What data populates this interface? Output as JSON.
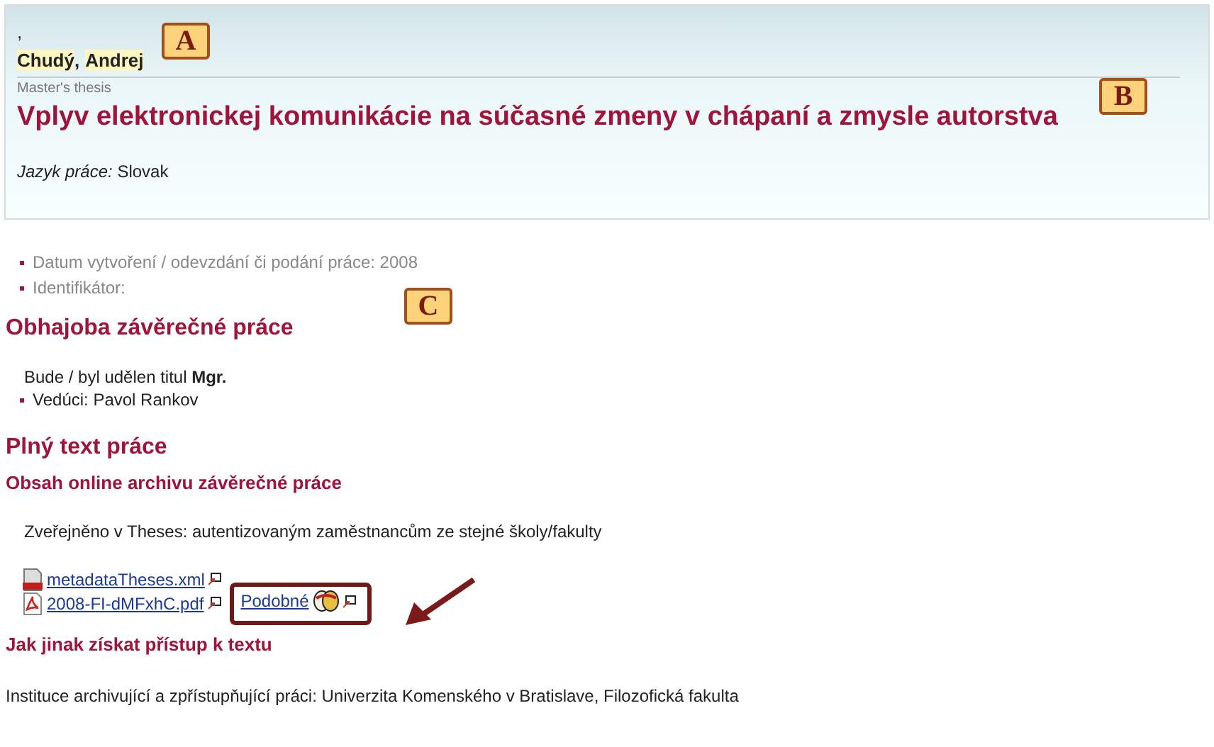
{
  "record": {
    "leading_mark": ",",
    "author": [
      {
        "text": "Chudý",
        "highlighted": true
      },
      {
        "text": ",",
        "highlighted": false
      },
      {
        "text": "Andrej",
        "highlighted": true
      }
    ],
    "type": "Master's thesis",
    "title": "Vplyv elektronickej komunikácie na súčasné zmeny v chápaní a zmysle autorstva",
    "language_label": "Jazyk práce:",
    "language": "Slovak"
  },
  "details": [
    "Datum vytvoření / odevzdání či podání práce: 2008",
    "Identifikátor:"
  ],
  "defense": {
    "heading": "Obhajoba závěrečné práce",
    "degree": "Bude / byl udělen titul **Mgr.**",
    "items": [
      "Vedúci: Pavol Rankov"
    ]
  },
  "fulltext": {
    "heading": "Plný text práce",
    "subheading": "Obsah online archivu závěrečné práce",
    "published": "Zveřejněno v Theses: autentizovaným zaměstnancům ze stejné školy/fakulty",
    "files": [
      {
        "kind": "xml",
        "name": "metadataTheses.xml"
      },
      {
        "kind": "pdf",
        "name": "2008-FI-dMFxhC.pdf"
      }
    ],
    "similar": "Podobné"
  },
  "access": {
    "heading": "Jak jinak získat přístup k textu",
    "institution": "Instituce archivující a zpřístupňující práci: Univerzita Komenského v Bratislave, Filozofická fakulta"
  },
  "callouts": [
    "A",
    "B",
    "C"
  ]
}
